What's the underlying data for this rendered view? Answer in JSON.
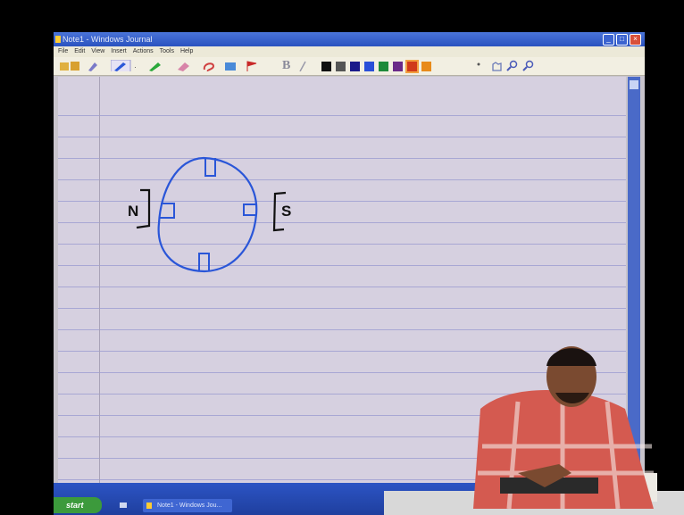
{
  "window": {
    "title": "Note1 - Windows Journal"
  },
  "window_controls": {
    "minimize": "_",
    "maximize": "□",
    "close": "×"
  },
  "menu": [
    "File",
    "Edit",
    "View",
    "Insert",
    "Actions",
    "Tools",
    "Help"
  ],
  "toolbar": {
    "bold": "B",
    "palette": [
      "#101010",
      "#555555",
      "#1a1a8a",
      "#2a4fd8",
      "#1e8a3a",
      "#6a2a88",
      "#d03a1a",
      "#e88a1a"
    ],
    "selected_color": "#d03a1a"
  },
  "drawing": {
    "label_north": "N",
    "label_south": "S",
    "ink_color": "#2a56d8"
  },
  "taskbar": {
    "start_label": "start",
    "task_label": "Note1 - Windows Jou..."
  }
}
